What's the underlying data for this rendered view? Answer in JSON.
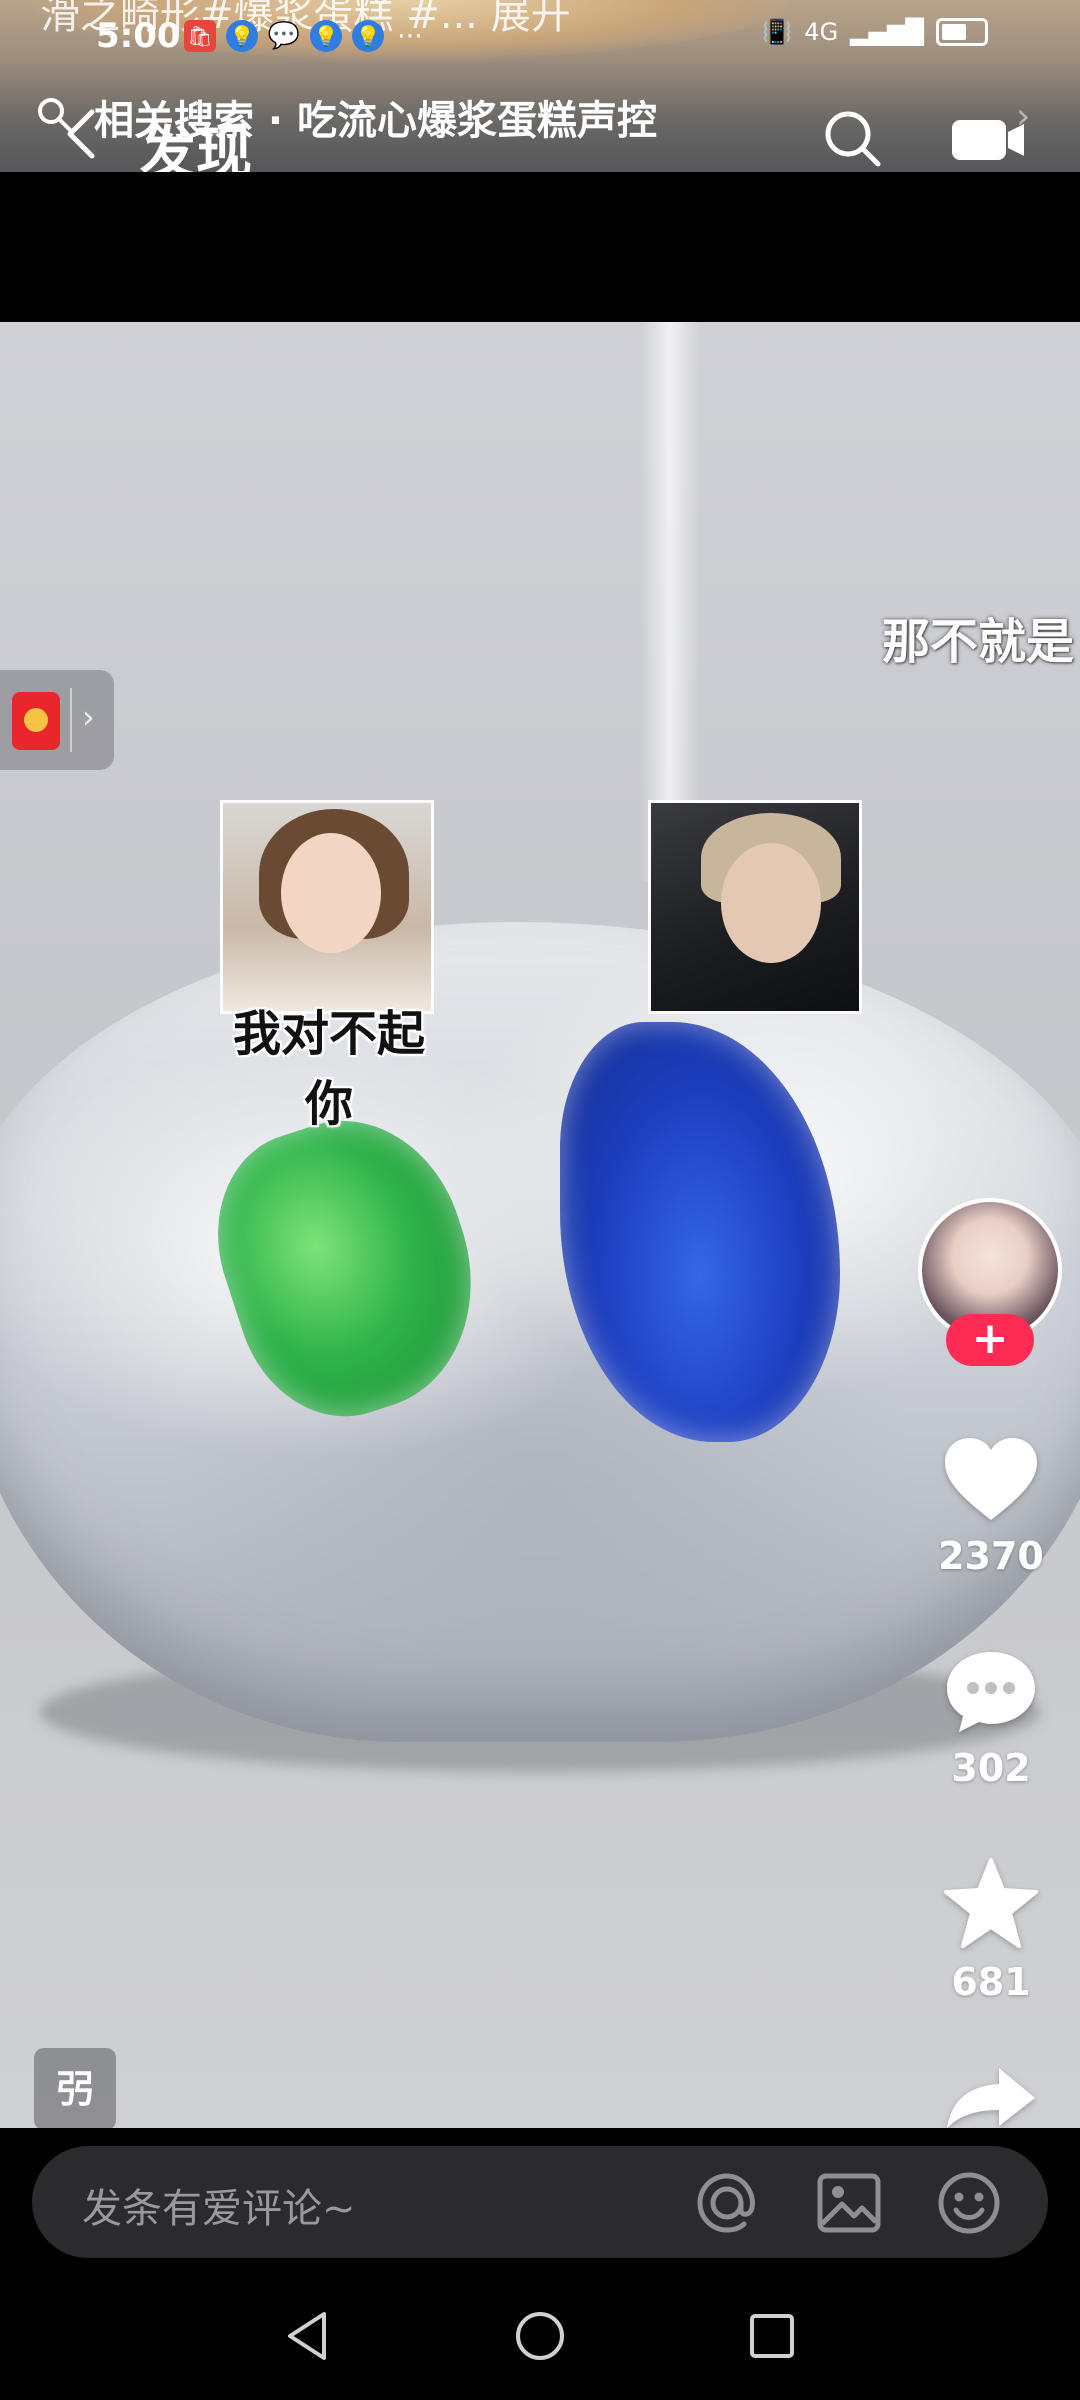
{
  "status_bar": {
    "faded_title": "滑之畸形#爆浆蛋糕 #... 展开",
    "time": "5:00",
    "network": "4G",
    "notification_icons": [
      "huawei-store-icon",
      "bulb-icon",
      "chat-bubble-icon",
      "bulb-icon",
      "bulb-icon",
      "more-dots"
    ]
  },
  "header": {
    "search_text": "相关搜索 · 吃流心爆浆蛋糕声控",
    "title": "发现"
  },
  "video": {
    "meme_caption": "我对不起你",
    "side_caption": "那不就是",
    "sound_badge": "弜"
  },
  "actions": {
    "like_count": "2370",
    "comment_count": "302",
    "favorite_count": "681",
    "follow_symbol": "+"
  },
  "comment_bar": {
    "placeholder": "发条有爱评论~"
  },
  "colors": {
    "follow_badge": "#fe2c55",
    "comment_bar_bg": "#2b2b2d",
    "red_packet": "#e8262b",
    "green_jelly": "#2fb44a",
    "blue_jelly": "#1d3fc0"
  }
}
